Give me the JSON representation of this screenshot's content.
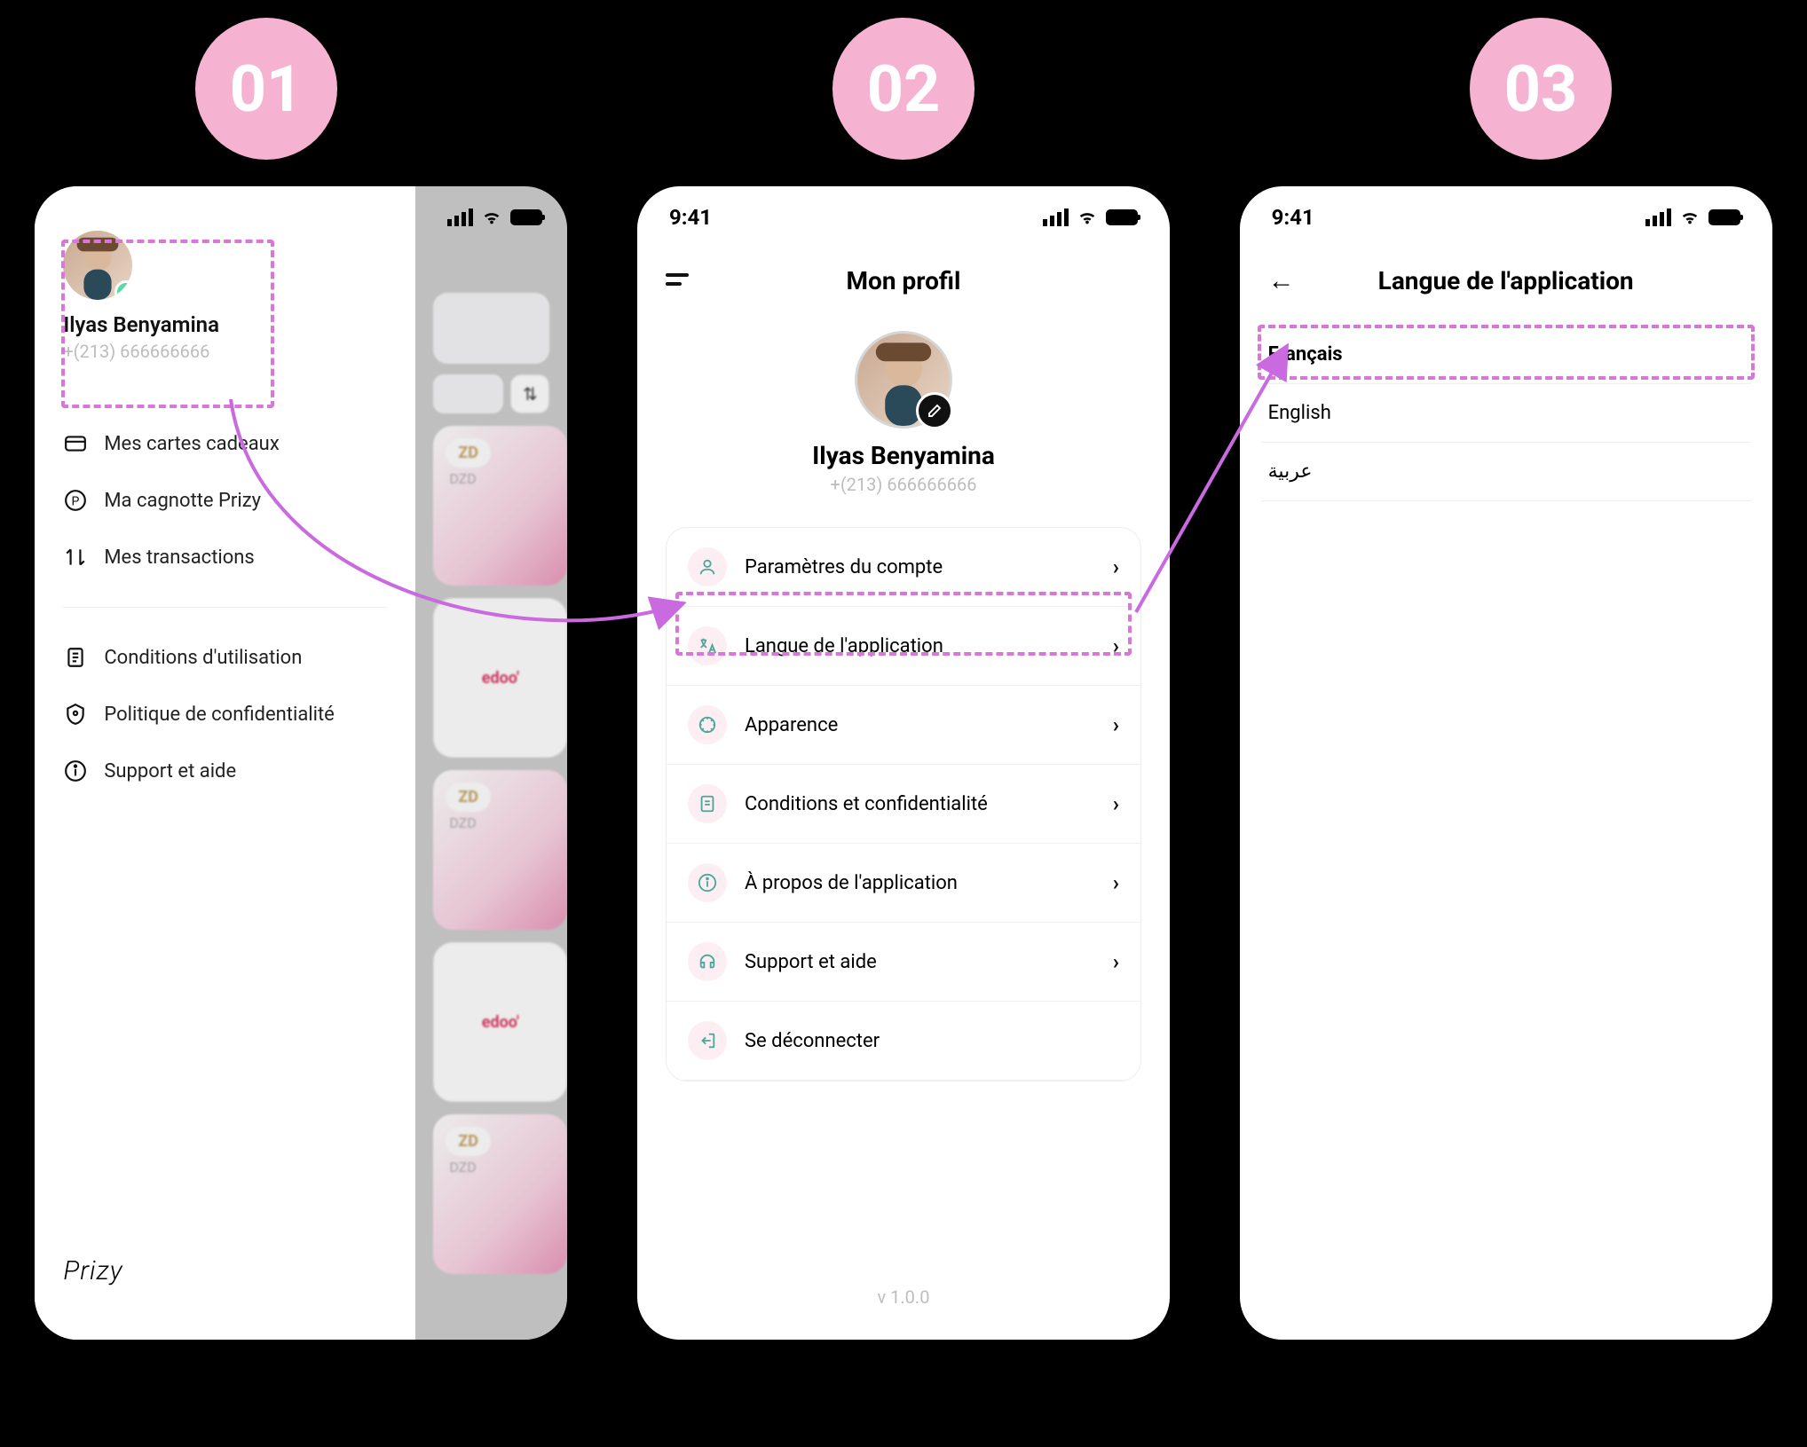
{
  "steps": {
    "s1": "01",
    "s2": "02",
    "s3": "03"
  },
  "status_time": "9:41",
  "user": {
    "name": "Ilyas Benyamina",
    "phone": "+(213) 666666666"
  },
  "drawer_menu": {
    "group1": [
      {
        "label": "Mes cartes cadeaux",
        "icon": "card"
      },
      {
        "label": "Ma cagnotte Prizy",
        "icon": "prizy"
      },
      {
        "label": "Mes transactions",
        "icon": "tx"
      }
    ],
    "group2": [
      {
        "label": "Conditions d'utilisation",
        "icon": "terms"
      },
      {
        "label": "Politique de confidentialité",
        "icon": "privacy"
      },
      {
        "label": "Support et aide",
        "icon": "help"
      }
    ],
    "brand": "Prizy"
  },
  "blurred": {
    "card_tag": "ZD",
    "card_sub": "DZD",
    "brand_logo": "edoo'"
  },
  "profile": {
    "header_title": "Mon profil",
    "items": [
      {
        "label": "Paramètres du compte",
        "icon": "user"
      },
      {
        "label": "Langue de l'application",
        "icon": "lang"
      },
      {
        "label": "Apparence",
        "icon": "appearance"
      },
      {
        "label": "Conditions et confidentialité",
        "icon": "doc"
      },
      {
        "label": "À propos de l'application",
        "icon": "info"
      },
      {
        "label": "Support et aide",
        "icon": "support"
      },
      {
        "label": "Se déconnecter",
        "icon": "logout",
        "no_chevron": true
      }
    ],
    "version": "v 1.0.0"
  },
  "language": {
    "header_title": "Langue de l'application",
    "options": [
      {
        "label": "Français",
        "selected": true
      },
      {
        "label": "English",
        "selected": false
      },
      {
        "label": "عربية",
        "selected": false
      }
    ]
  }
}
